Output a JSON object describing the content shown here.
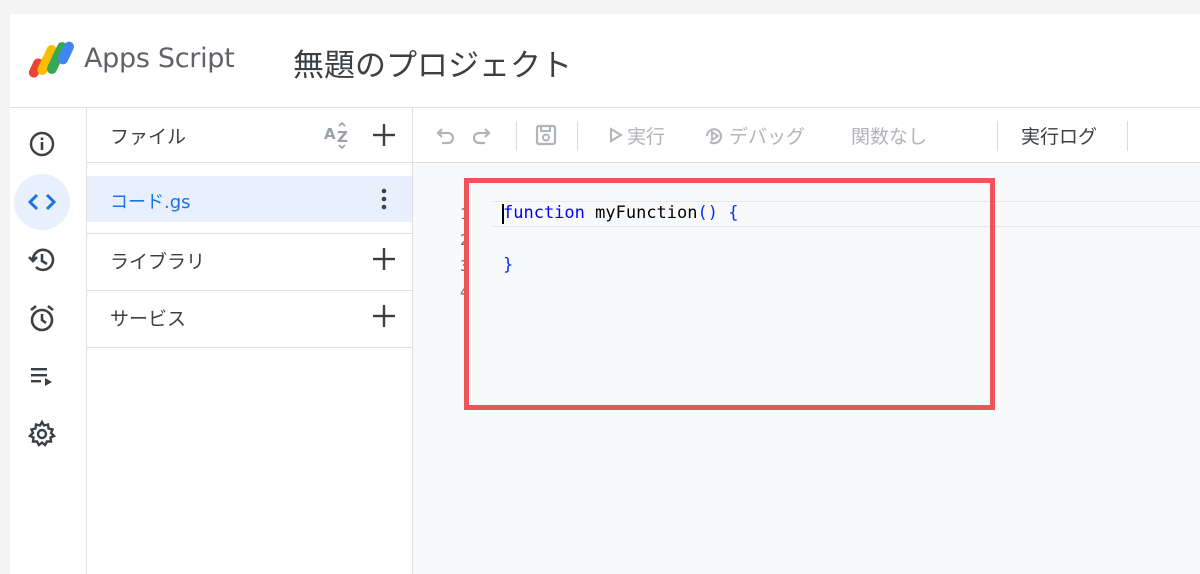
{
  "header": {
    "app_name": "Apps Script",
    "project_title": "無題のプロジェクト"
  },
  "rail": {
    "items": [
      {
        "icon": "info-icon"
      },
      {
        "icon": "code-icon",
        "active": true
      },
      {
        "icon": "history-icon"
      },
      {
        "icon": "alarm-icon"
      },
      {
        "icon": "run-list-icon"
      },
      {
        "icon": "gear-icon"
      }
    ]
  },
  "files_panel": {
    "files_label": "ファイル",
    "file": {
      "name": "コード.gs"
    },
    "libraries_label": "ライブラリ",
    "services_label": "サービス"
  },
  "toolbar": {
    "run_label": "実行",
    "debug_label": "デバッグ",
    "function_select": "関数なし",
    "log_label": "実行ログ"
  },
  "editor": {
    "line_numbers": [
      "1",
      "2",
      "3",
      "4"
    ],
    "code": {
      "keyword": "function",
      "fn_name": "myFunction",
      "params": "()",
      "open_brace": "{",
      "close_brace": "}"
    }
  },
  "colors": {
    "accent": "#1a73e8",
    "active_bg": "#e8f0fe",
    "highlight": "#f0545a"
  }
}
